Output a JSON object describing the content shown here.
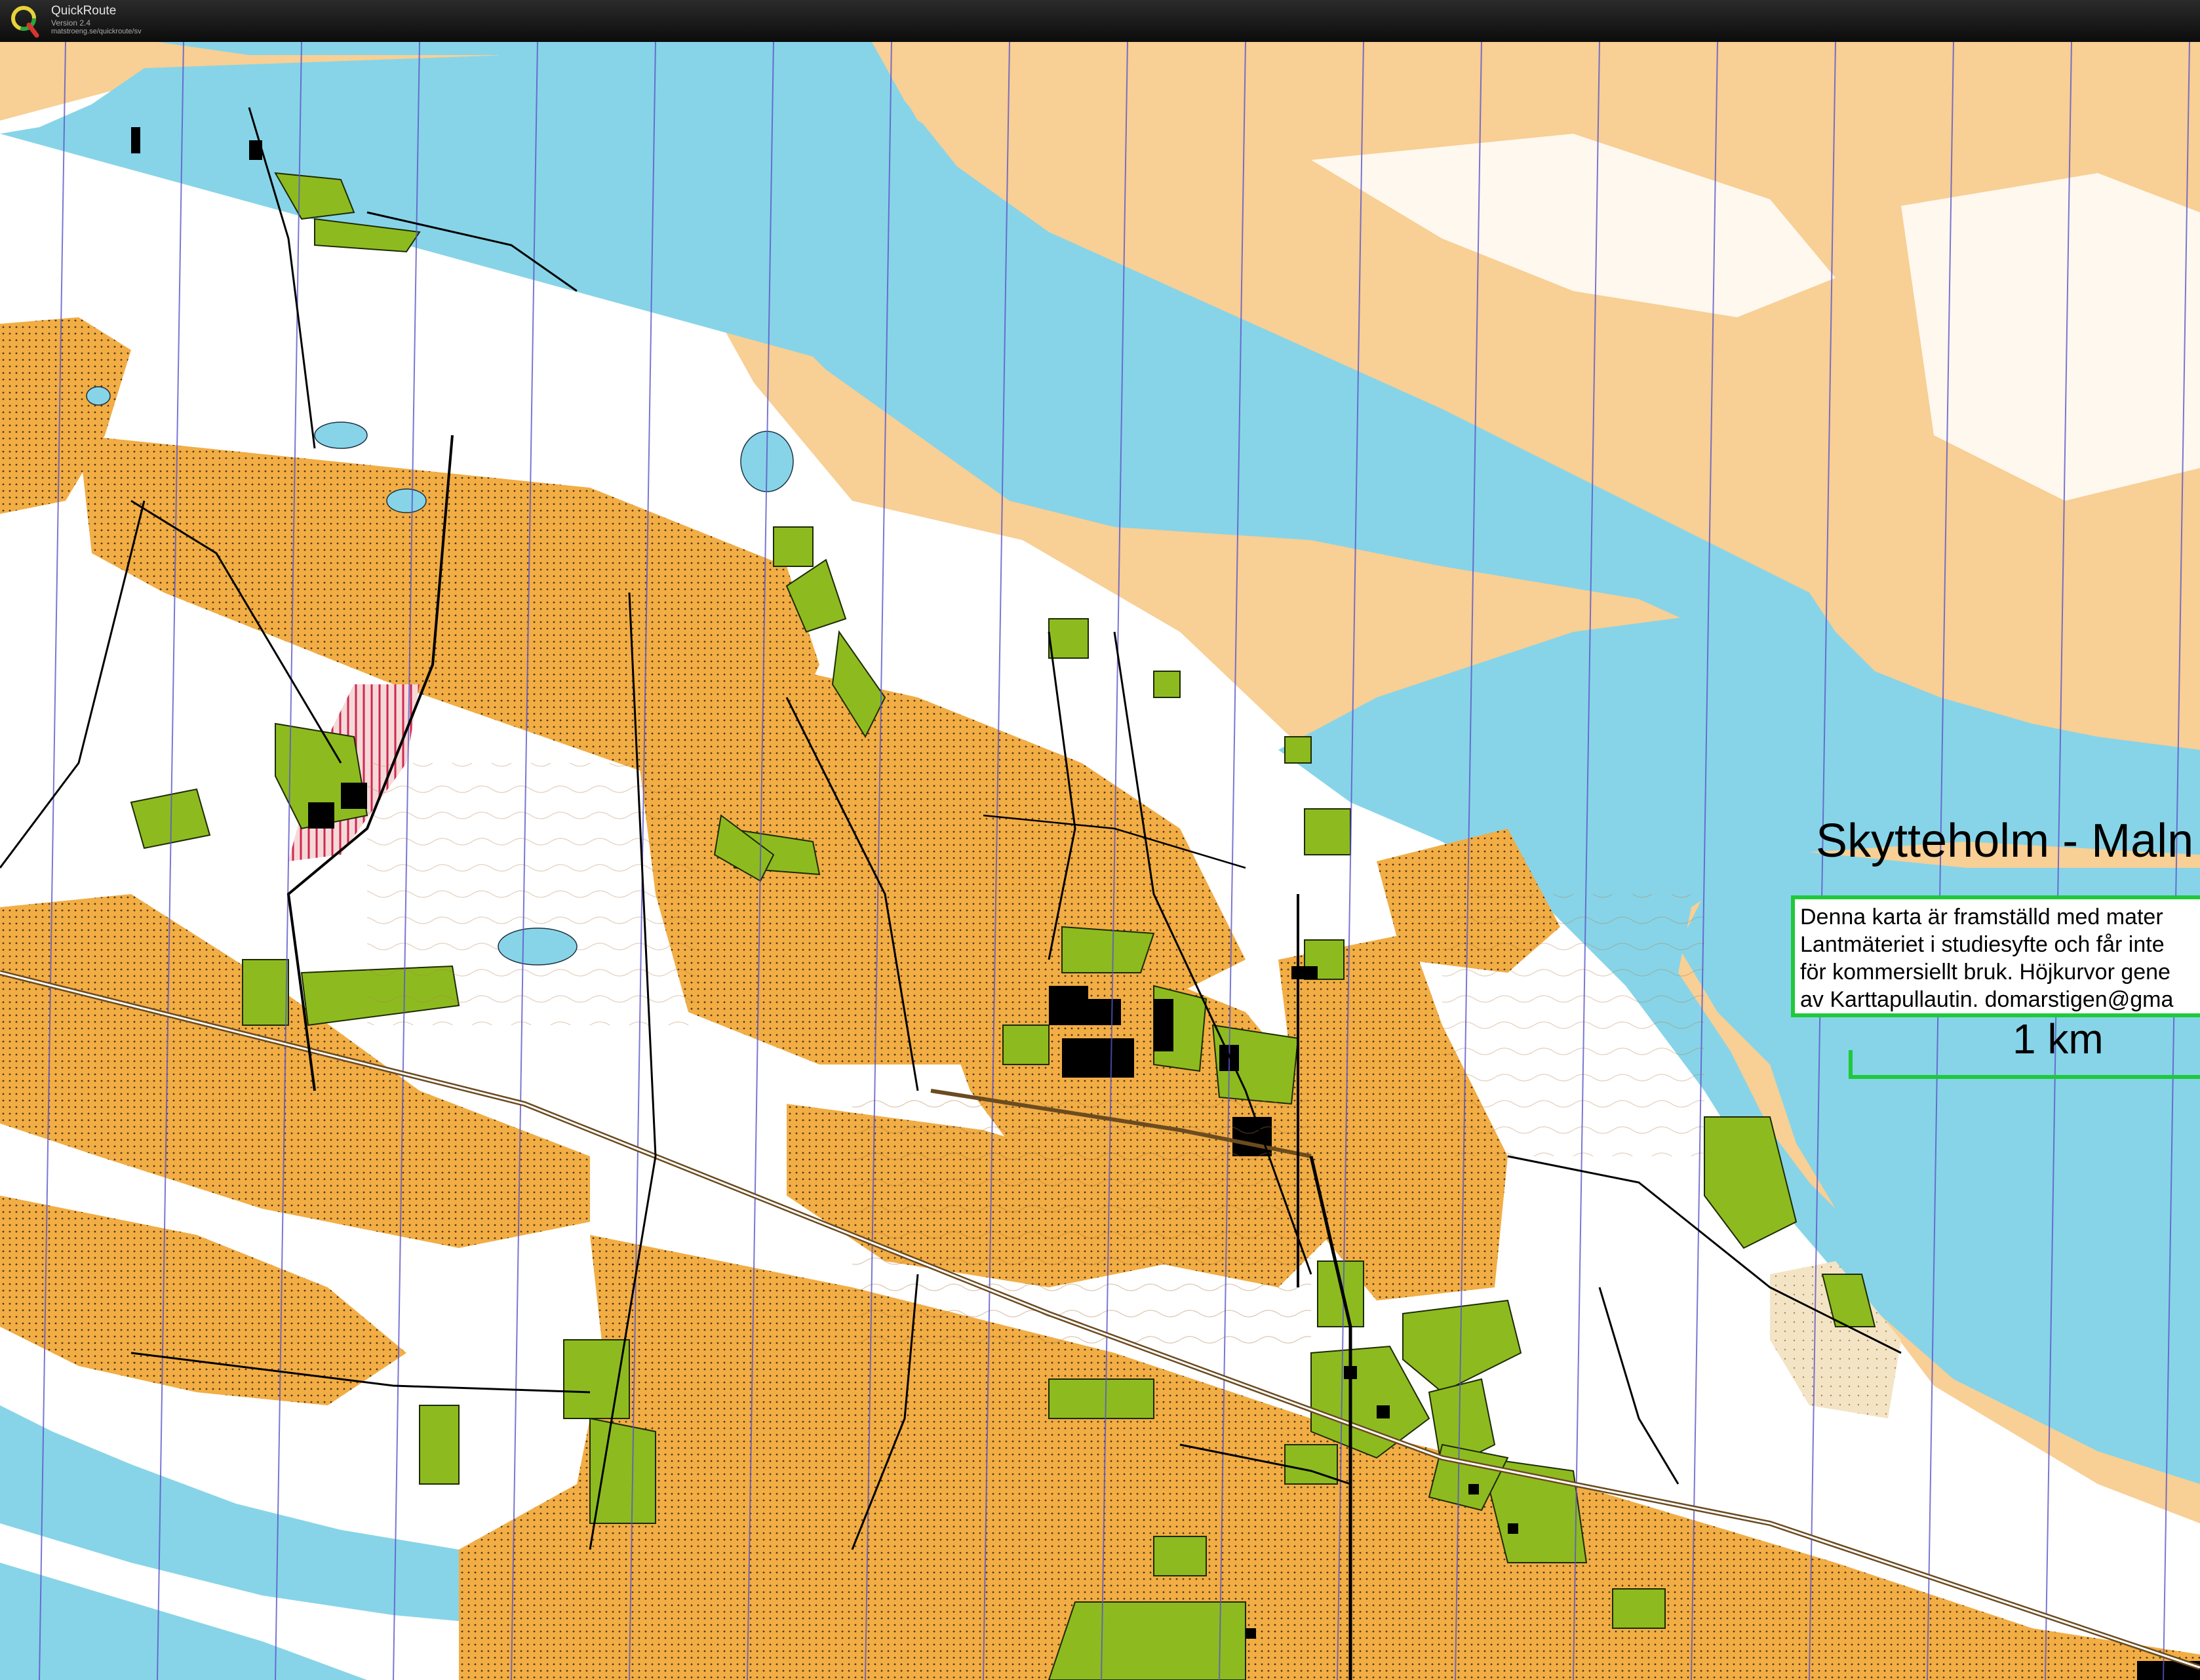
{
  "app": {
    "name": "QuickRoute",
    "version": "Version 2.4",
    "url": "matstroeng.se/quickroute/sv",
    "logo_letter": "Q",
    "logo_icon": "quickroute-logo-icon"
  },
  "map": {
    "title": "Skytteholm - Maln",
    "copyright_lines": [
      "Denna karta är framställd med mater",
      "Lantmäteriet i studiesyfte och får inte",
      "för kommersiellt bruk. Höjkurvor gene",
      "av Karttapullautin. domarstigen@gma"
    ],
    "scale_label": "1 km",
    "colors": {
      "water": "#87d4e8",
      "open_land": "#f8cf94",
      "rough_open": "#f2ad44",
      "forest": "#ffffff",
      "green": "#8dbb1f",
      "legend_accent": "#1fc93a",
      "magnetic_north_lines": "#5b55c9",
      "restricted": "#d0284f"
    }
  }
}
